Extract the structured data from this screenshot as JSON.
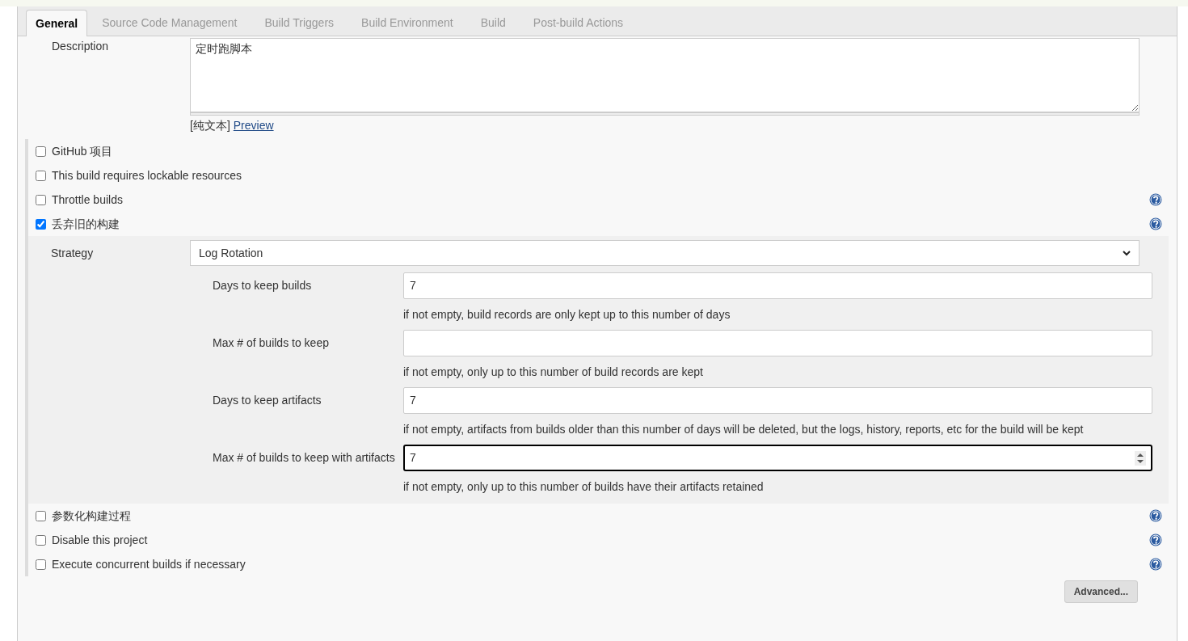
{
  "tabs": [
    {
      "label": "General",
      "selected": true
    },
    {
      "label": "Source Code Management",
      "selected": false
    },
    {
      "label": "Build Triggers",
      "selected": false
    },
    {
      "label": "Build Environment",
      "selected": false
    },
    {
      "label": "Build",
      "selected": false
    },
    {
      "label": "Post-build Actions",
      "selected": false
    }
  ],
  "description": {
    "label": "Description",
    "value": "定时跑脚本",
    "format": "[纯文本]",
    "preview_link": "Preview"
  },
  "options": [
    {
      "label": "GitHub 项目",
      "checked": false,
      "help": false
    },
    {
      "label": "This build requires lockable resources",
      "checked": false,
      "help": false
    },
    {
      "label": "Throttle builds",
      "checked": false,
      "help": true
    },
    {
      "label": "丢弃旧的构建",
      "checked": true,
      "help": true,
      "strategy": {
        "label": "Strategy",
        "value": "Log Rotation",
        "fields": [
          {
            "label": "Days to keep builds",
            "value": "7",
            "hint": "if not empty, build records are only kept up to this number of days",
            "focused": false
          },
          {
            "label": "Max # of builds to keep",
            "hint": "if not empty, only up to this number of build records are kept",
            "focused": false
          },
          {
            "label": "Days to keep artifacts",
            "value": "7",
            "hint": "if not empty, artifacts from builds older than this number of days will be deleted, but the logs, history, reports, etc for the build will be kept",
            "focused": false
          },
          {
            "label": "Max # of builds to keep with artifacts",
            "value": "7",
            "hint": "if not empty, only up to this number of builds have their artifacts retained",
            "focused": true
          }
        ]
      }
    },
    {
      "label": "参数化构建过程",
      "checked": false,
      "help": true
    },
    {
      "label": "Disable this project",
      "checked": false,
      "help": true
    },
    {
      "label": "Execute concurrent builds if necessary",
      "checked": false,
      "help": true
    }
  ],
  "advanced_button": "Advanced..."
}
